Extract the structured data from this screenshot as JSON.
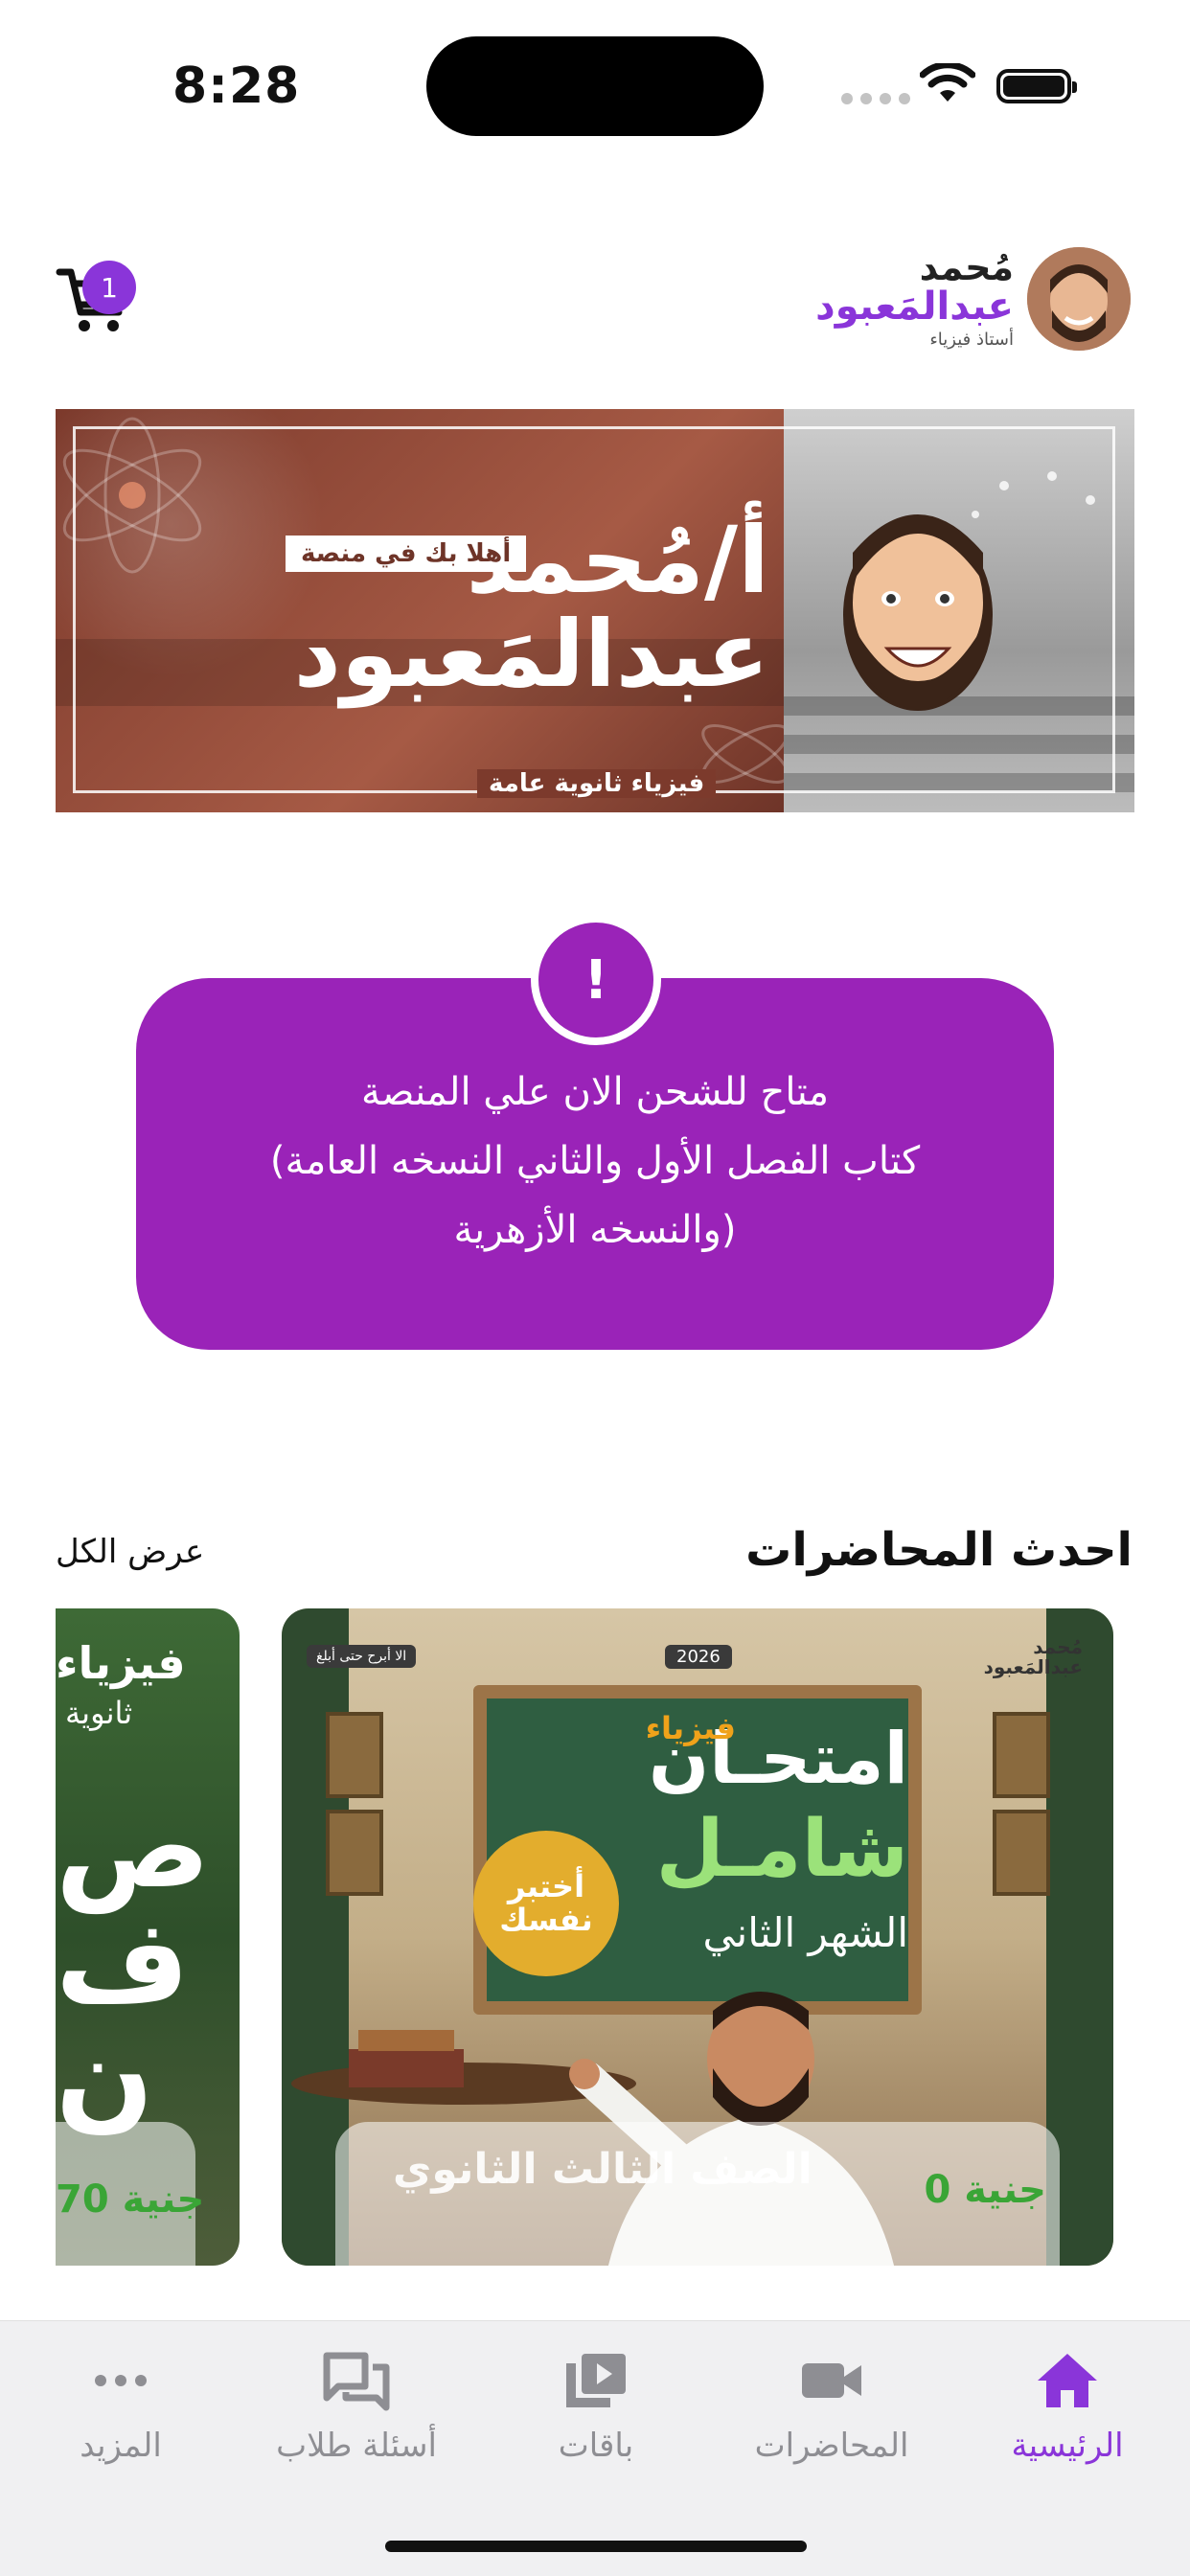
{
  "status_bar": {
    "time": "8:28"
  },
  "header": {
    "cart_count": "1",
    "brand": {
      "line1": "مُحمد",
      "line2": "عبدالمَعبود",
      "tagline": "أستاذ فيزياء"
    }
  },
  "banner": {
    "welcome": "أهلا بك في منصة",
    "title_prefix": "أ/",
    "title_line1": "مُحمد",
    "title_line2": "عبدالمَعبود",
    "subtitle": "فيزياء ثانوية عامة"
  },
  "notice": {
    "badge": "!",
    "line1": "متاح للشحن  الان علي المنصة",
    "line2": "(كتاب الفصل الأول والثاني النسخه العامة",
    "line3": "والنسخه الأزهرية)"
  },
  "lectures_section": {
    "title": "احدث المحاضرات",
    "view_all": "عرض الكل"
  },
  "cards": [
    {
      "tag": "الا أبرح حتى أبلغ",
      "year": "2026",
      "logo_line1": "مُحمد",
      "logo_line2": "عبدالمَعبود",
      "board_top": "امتحـان",
      "board_word": "فيزياء",
      "board_mid": "شامـل",
      "board_bottom": "الشهر الثاني",
      "seal": "أختبر نفسك",
      "grade": "الصف الثالث الثانوي",
      "price": "0 جنية"
    },
    {
      "title": "فيزياء",
      "subtitle": "ثانوية",
      "big_letters": "ص ف ن",
      "price": "70 جنية"
    }
  ],
  "tabbar": [
    {
      "label": "الرئيسية",
      "icon": "home-icon",
      "active": true
    },
    {
      "label": "المحاضرات",
      "icon": "video-camera-icon",
      "active": false
    },
    {
      "label": "باقات",
      "icon": "playlist-icon",
      "active": false
    },
    {
      "label": "أسئلة طلاب",
      "icon": "chat-bubbles-icon",
      "active": false
    },
    {
      "label": "المزيد",
      "icon": "more-dots-icon",
      "active": false
    }
  ],
  "colors": {
    "accent": "#8a35d9",
    "notice_bg": "#9a23b8",
    "price_green": "#3aa536",
    "tab_inactive": "#8e8e93"
  }
}
